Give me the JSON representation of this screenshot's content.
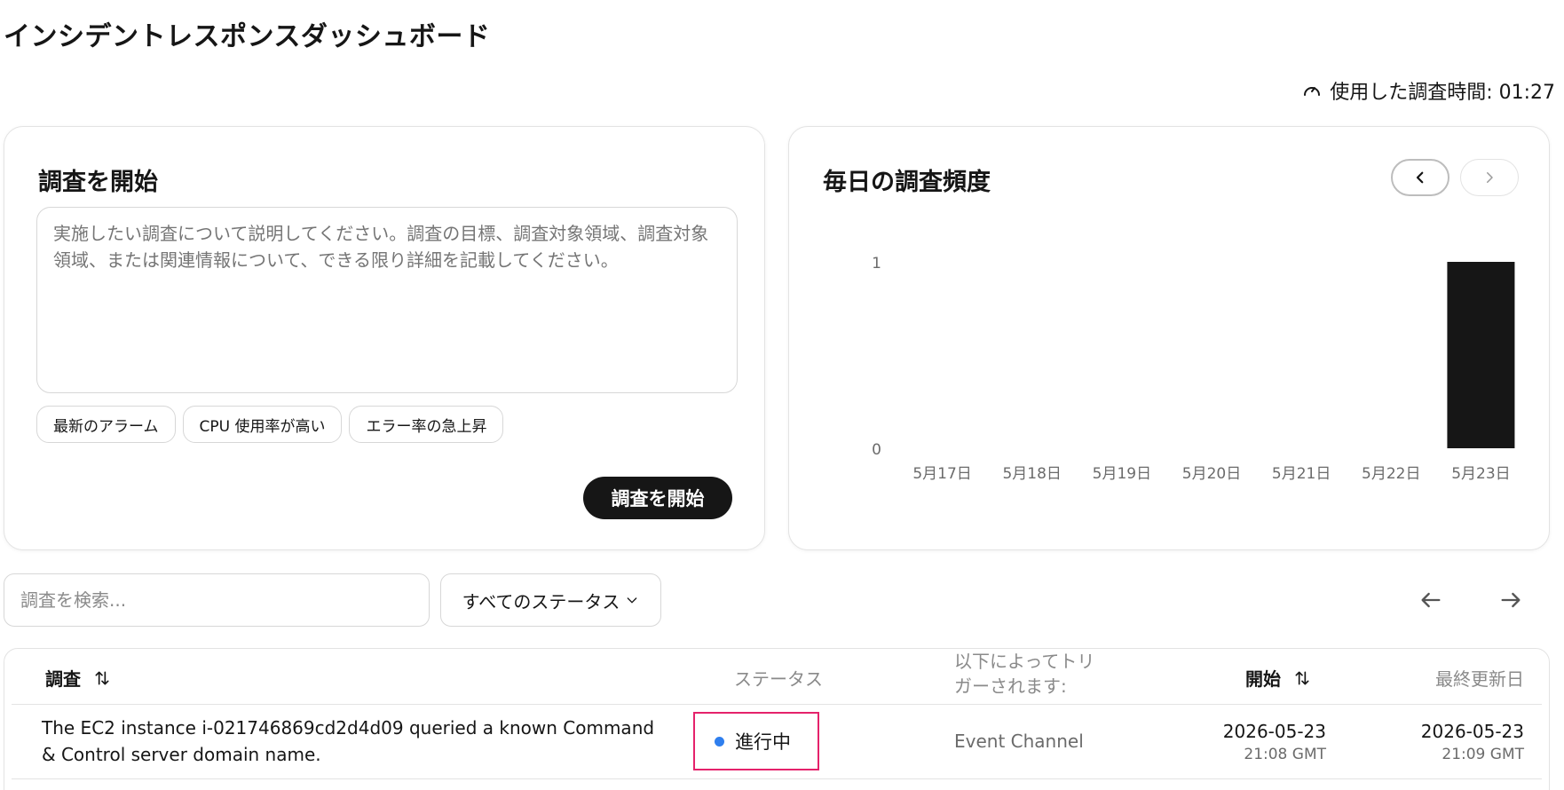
{
  "page_title": "インシデントレスポンスダッシュボード",
  "time_used": {
    "icon": "gauge-icon",
    "label": "使用した調査時間: 01:27"
  },
  "start_card": {
    "title": "調査を開始",
    "prompt_placeholder": "実施したい調査について説明してください。調査の目標、調査対象領域、調査対象領域、または関連情報について、できる限り詳細を記載してください。",
    "chips": [
      "最新のアラーム",
      "CPU 使用率が高い",
      "エラー率の急上昇"
    ],
    "start_button": "調査を開始"
  },
  "chart_card": {
    "title": "毎日の調査頻度",
    "prev_icon": "chevron-left-icon",
    "next_icon": "chevron-right-icon"
  },
  "chart_data": {
    "type": "bar",
    "title": "毎日の調査頻度",
    "categories": [
      "5月17日",
      "5月18日",
      "5月19日",
      "5月20日",
      "5月21日",
      "5月22日",
      "5月23日"
    ],
    "values": [
      0,
      0,
      0,
      0,
      0,
      0,
      1
    ],
    "y_ticks": [
      "0",
      "1"
    ],
    "ylim": [
      0,
      1
    ],
    "grid": false,
    "bar_color": "#161616"
  },
  "filters": {
    "search_placeholder": "調査を検索...",
    "status_select": "すべてのステータス"
  },
  "table": {
    "headers": {
      "investigation": "調査",
      "status": "ステータス",
      "trigger": "以下によってトリガーされます:",
      "start": "開始",
      "last_updated": "最終更新日"
    },
    "rows": [
      {
        "title": "The EC2 instance i-021746869cd2d4d09 queried a known Command & Control server domain name.",
        "status": "進行中",
        "status_color": "#2f7fee",
        "trigger": "Event Channel",
        "start_date": "2026-05-23",
        "start_time": "21:08 GMT",
        "updated_date": "2026-05-23",
        "updated_time": "21:09 GMT"
      }
    ]
  }
}
